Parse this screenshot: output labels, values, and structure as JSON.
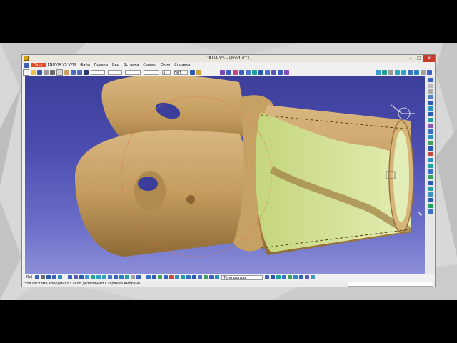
{
  "window": {
    "title": "CATIA V5 - [Product1]",
    "controls": {
      "minimize": "–",
      "maximize": "□",
      "close": "✕"
    }
  },
  "menu": {
    "items": [
      "Пуск",
      "ENOVIA V5 VPM",
      "Файл",
      "Правка",
      "Вид",
      "Вставка",
      "Сервис",
      "Окно",
      "Справка"
    ]
  },
  "toolbar": {
    "combo_values": [
      "",
      "",
      "",
      "",
      "3",
      "Нет"
    ],
    "icon_names": [
      "new-icon",
      "open-icon",
      "save-icon",
      "print-icon",
      "cut-icon",
      "copy-icon",
      "paste-icon",
      "undo-icon",
      "redo-icon",
      "whats-this-icon"
    ]
  },
  "bottom_toolbar": {
    "fx_label": "f(x)",
    "body_combo_value": "Тело детали"
  },
  "status": {
    "message": "Эта система координат \\ Тело детали\\Part1 заранее выбрано"
  },
  "colors": {
    "accent_menu": "#e24a2a",
    "viewport_top": "#3c3f9a",
    "viewport_bottom": "#8b8ed8",
    "part_color": "#c8a46a",
    "highlight_green": "#c9dc8c",
    "close_button": "#c83a2c"
  }
}
